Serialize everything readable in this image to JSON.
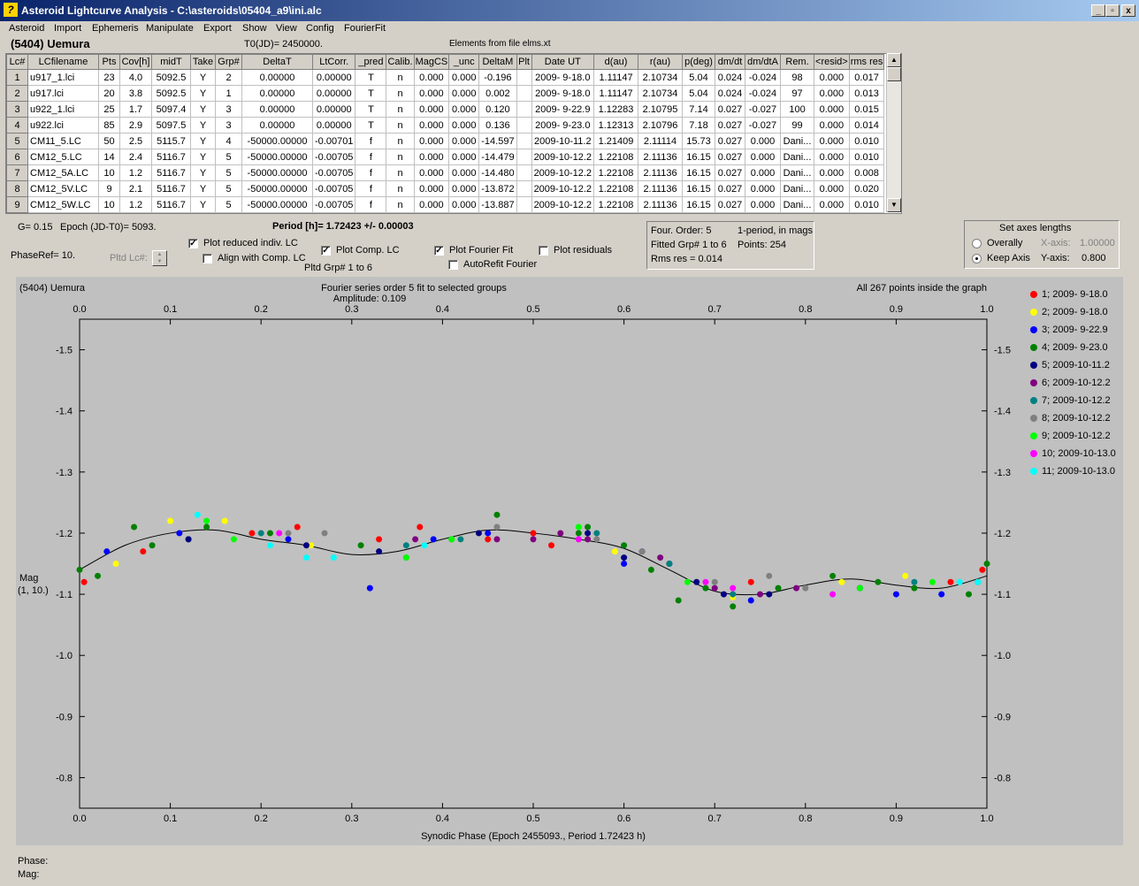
{
  "window": {
    "title": "Asteroid Lightcurve Analysis - C:\\asteroids\\05404_a9\\ini.alc",
    "min_label": "_",
    "max_label": "▫",
    "close_label": "x"
  },
  "menu": [
    "Asteroid",
    "Import",
    "Ephemeris",
    "Manipulate",
    "Export",
    "Show",
    "View",
    "Config",
    "FourierFit"
  ],
  "header": {
    "asteroid": "(5404) Uemura",
    "t0": "T0(JD)= 2450000.",
    "elements": "Elements from file elms.xt"
  },
  "table": {
    "columns": [
      "Lc#",
      "LCfilename",
      "Pts",
      "Cov[h]",
      "midT",
      "Take",
      "Grp#",
      "DeltaT",
      "LtCorr.",
      "_pred",
      "Calib.",
      "MagCS",
      "_unc",
      "DeltaM",
      "Plt",
      "Date UT",
      "d(au)",
      "r(au)",
      "p(deg)",
      "dm/dt",
      "dm/dtA",
      "Rem.",
      "<resid>",
      "rms res"
    ],
    "rows": [
      [
        "1",
        "u917_1.lci",
        "23",
        "4.0",
        "5092.5",
        "Y",
        "2",
        "0.00000",
        "0.00000",
        "T",
        "n",
        "0.000",
        "0.000",
        "-0.196",
        "",
        "2009- 9-18.0",
        "1.11147",
        "2.10734",
        "5.04",
        "0.024",
        "-0.024",
        "98",
        "0.000",
        "0.017"
      ],
      [
        "2",
        "u917.lci",
        "20",
        "3.8",
        "5092.5",
        "Y",
        "1",
        "0.00000",
        "0.00000",
        "T",
        "n",
        "0.000",
        "0.000",
        "0.002",
        "",
        "2009- 9-18.0",
        "1.11147",
        "2.10734",
        "5.04",
        "0.024",
        "-0.024",
        "97",
        "0.000",
        "0.013"
      ],
      [
        "3",
        "u922_1.lci",
        "25",
        "1.7",
        "5097.4",
        "Y",
        "3",
        "0.00000",
        "0.00000",
        "T",
        "n",
        "0.000",
        "0.000",
        "0.120",
        "",
        "2009- 9-22.9",
        "1.12283",
        "2.10795",
        "7.14",
        "0.027",
        "-0.027",
        "100",
        "0.000",
        "0.015"
      ],
      [
        "4",
        "u922.lci",
        "85",
        "2.9",
        "5097.5",
        "Y",
        "3",
        "0.00000",
        "0.00000",
        "T",
        "n",
        "0.000",
        "0.000",
        "0.136",
        "",
        "2009- 9-23.0",
        "1.12313",
        "2.10796",
        "7.18",
        "0.027",
        "-0.027",
        "99",
        "0.000",
        "0.014"
      ],
      [
        "5",
        "CM11_5.LC",
        "50",
        "2.5",
        "5115.7",
        "Y",
        "4",
        "-50000.00000",
        "-0.00701",
        "f",
        "n",
        "0.000",
        "0.000",
        "-14.597",
        "",
        "2009-10-11.2",
        "1.21409",
        "2.11114",
        "15.73",
        "0.027",
        "0.000",
        "Dani...",
        "0.000",
        "0.010"
      ],
      [
        "6",
        "CM12_5.LC",
        "14",
        "2.4",
        "5116.7",
        "Y",
        "5",
        "-50000.00000",
        "-0.00705",
        "f",
        "n",
        "0.000",
        "0.000",
        "-14.479",
        "",
        "2009-10-12.2",
        "1.22108",
        "2.11136",
        "16.15",
        "0.027",
        "0.000",
        "Dani...",
        "0.000",
        "0.010"
      ],
      [
        "7",
        "CM12_5A.LC",
        "10",
        "1.2",
        "5116.7",
        "Y",
        "5",
        "-50000.00000",
        "-0.00705",
        "f",
        "n",
        "0.000",
        "0.000",
        "-14.480",
        "",
        "2009-10-12.2",
        "1.22108",
        "2.11136",
        "16.15",
        "0.027",
        "0.000",
        "Dani...",
        "0.000",
        "0.008"
      ],
      [
        "8",
        "CM12_5V.LC",
        "9",
        "2.1",
        "5116.7",
        "Y",
        "5",
        "-50000.00000",
        "-0.00705",
        "f",
        "n",
        "0.000",
        "0.000",
        "-13.872",
        "",
        "2009-10-12.2",
        "1.22108",
        "2.11136",
        "16.15",
        "0.027",
        "0.000",
        "Dani...",
        "0.000",
        "0.020"
      ],
      [
        "9",
        "CM12_5W.LC",
        "10",
        "1.2",
        "5116.7",
        "Y",
        "5",
        "-50000.00000",
        "-0.00705",
        "f",
        "n",
        "0.000",
        "0.000",
        "-13.887",
        "",
        "2009-10-12.2",
        "1.22108",
        "2.11136",
        "16.15",
        "0.027",
        "0.000",
        "Dani...",
        "0.000",
        "0.010"
      ]
    ]
  },
  "params": {
    "g": "G= 0.15",
    "epoch": "Epoch (JD-T0)= 5093.",
    "period": "Period [h]= 1.72423 +/- 0.00003",
    "phaseref": "PhaseRef= 10.",
    "pltd_lc": "Pltd Lc#:",
    "pltd_grp": "Pltd Grp#  1   to   6"
  },
  "options": {
    "plot_reduced": {
      "label": "Plot reduced indiv. LC",
      "checked": true
    },
    "align_comp": {
      "label": "Align with Comp. LC",
      "checked": false
    },
    "plot_comp": {
      "label": "Plot Comp. LC",
      "checked": true
    },
    "plot_fourier": {
      "label": "Plot Fourier Fit",
      "checked": true
    },
    "autorefit": {
      "label": "AutoRefit Fourier",
      "checked": false
    },
    "plot_residuals": {
      "label": "Plot residuals",
      "checked": false
    }
  },
  "fourier_info": {
    "order": "Four. Order:  5",
    "mode": "1-period, in mags",
    "fitted": "Fitted Grp# 1 to 6",
    "points": "Points: 254",
    "rms": "Rms res     = 0.014"
  },
  "axes_box": {
    "title": "Set axes lengths",
    "overally": "Overally",
    "keep": "Keep Axis",
    "x_label": "X-axis:",
    "x_value": "1.00000",
    "y_label": "Y-axis:",
    "y_value": "0.800",
    "selected": "keep"
  },
  "plot": {
    "name": "(5404) Uemura",
    "fit_title": "Fourier series order 5 fit to selected groups",
    "amplitude": "Amplitude: 0.109",
    "points_note": "All 267 points inside the graph",
    "ylabel": "Mag",
    "ylabel2": "(1, 10.)",
    "xlabel": "Synodic Phase (Epoch 2455093., Period 1.72423 h)"
  },
  "legend": [
    {
      "label": "1; 2009- 9-18.0",
      "color": "#ff0000"
    },
    {
      "label": "2; 2009- 9-18.0",
      "color": "#ffff00"
    },
    {
      "label": "3; 2009- 9-22.9",
      "color": "#0000ff"
    },
    {
      "label": "4; 2009- 9-23.0",
      "color": "#008000"
    },
    {
      "label": "5; 2009-10-11.2",
      "color": "#000080"
    },
    {
      "label": "6; 2009-10-12.2",
      "color": "#800080"
    },
    {
      "label": "7; 2009-10-12.2",
      "color": "#008080"
    },
    {
      "label": "8; 2009-10-12.2",
      "color": "#808080"
    },
    {
      "label": "9; 2009-10-12.2",
      "color": "#00ff00"
    },
    {
      "label": "10; 2009-10-13.0",
      "color": "#ff00ff"
    },
    {
      "label": "11; 2009-10-13.0",
      "color": "#00ffff"
    }
  ],
  "status": {
    "phase": "Phase:",
    "mag": "Mag:"
  },
  "chart_data": {
    "type": "scatter",
    "xlabel": "Synodic Phase (Epoch 2455093., Period 1.72423 h)",
    "ylabel": "Mag",
    "xlim": [
      0.0,
      1.0
    ],
    "ylim": [
      -1.55,
      -0.75
    ],
    "y_inverted": true,
    "xticks": [
      "0.0",
      "0.1",
      "0.2",
      "0.3",
      "0.4",
      "0.5",
      "0.6",
      "0.7",
      "0.8",
      "0.9",
      "1.0"
    ],
    "yticks": [
      "-1.5",
      "-1.4",
      "-1.3",
      "-1.2",
      "-1.1",
      "-1.0",
      "-0.9",
      "-0.8"
    ],
    "fit_curve": {
      "name": "Fourier fit",
      "x": [
        0.0,
        0.05,
        0.1,
        0.15,
        0.2,
        0.25,
        0.3,
        0.35,
        0.4,
        0.45,
        0.5,
        0.55,
        0.6,
        0.65,
        0.7,
        0.75,
        0.8,
        0.85,
        0.9,
        0.95,
        1.0
      ],
      "y": [
        -1.14,
        -1.18,
        -1.2,
        -1.205,
        -1.19,
        -1.18,
        -1.165,
        -1.17,
        -1.19,
        -1.205,
        -1.2,
        -1.19,
        -1.175,
        -1.14,
        -1.105,
        -1.1,
        -1.115,
        -1.125,
        -1.115,
        -1.11,
        -1.13
      ]
    },
    "series": [
      {
        "name": "1; 2009- 9-18.0",
        "color": "#ff0000",
        "points": [
          [
            0.005,
            -1.12
          ],
          [
            0.07,
            -1.17
          ],
          [
            0.19,
            -1.2
          ],
          [
            0.24,
            -1.21
          ],
          [
            0.33,
            -1.19
          ],
          [
            0.375,
            -1.21
          ],
          [
            0.45,
            -1.19
          ],
          [
            0.5,
            -1.2
          ],
          [
            0.52,
            -1.18
          ],
          [
            0.74,
            -1.12
          ],
          [
            0.96,
            -1.12
          ],
          [
            0.995,
            -1.14
          ]
        ]
      },
      {
        "name": "2; 2009- 9-18.0",
        "color": "#ffff00",
        "points": [
          [
            0.04,
            -1.15
          ],
          [
            0.1,
            -1.22
          ],
          [
            0.16,
            -1.22
          ],
          [
            0.255,
            -1.18
          ],
          [
            0.42,
            -1.19
          ],
          [
            0.59,
            -1.17
          ],
          [
            0.72,
            -1.095
          ],
          [
            0.84,
            -1.12
          ],
          [
            0.91,
            -1.13
          ]
        ]
      },
      {
        "name": "3; 2009- 9-22.9",
        "color": "#0000ff",
        "points": [
          [
            0.03,
            -1.17
          ],
          [
            0.11,
            -1.2
          ],
          [
            0.23,
            -1.19
          ],
          [
            0.32,
            -1.11
          ],
          [
            0.39,
            -1.19
          ],
          [
            0.45,
            -1.2
          ],
          [
            0.6,
            -1.15
          ],
          [
            0.62,
            -1.17
          ],
          [
            0.74,
            -1.09
          ],
          [
            0.9,
            -1.1
          ],
          [
            0.95,
            -1.1
          ]
        ]
      },
      {
        "name": "4; 2009- 9-23.0",
        "color": "#008000",
        "points": [
          [
            0.0,
            -1.14
          ],
          [
            0.02,
            -1.13
          ],
          [
            0.06,
            -1.21
          ],
          [
            0.08,
            -1.18
          ],
          [
            0.12,
            -1.19
          ],
          [
            0.14,
            -1.21
          ],
          [
            0.21,
            -1.2
          ],
          [
            0.31,
            -1.18
          ],
          [
            0.36,
            -1.16
          ],
          [
            0.41,
            -1.19
          ],
          [
            0.46,
            -1.23
          ],
          [
            0.55,
            -1.2
          ],
          [
            0.56,
            -1.21
          ],
          [
            0.6,
            -1.18
          ],
          [
            0.63,
            -1.14
          ],
          [
            0.66,
            -1.09
          ],
          [
            0.69,
            -1.11
          ],
          [
            0.72,
            -1.08
          ],
          [
            0.77,
            -1.11
          ],
          [
            0.83,
            -1.13
          ],
          [
            0.88,
            -1.12
          ],
          [
            0.92,
            -1.11
          ],
          [
            0.98,
            -1.1
          ],
          [
            1.0,
            -1.15
          ]
        ]
      },
      {
        "name": "5; 2009-10-11.2",
        "color": "#000080",
        "points": [
          [
            0.12,
            -1.19
          ],
          [
            0.25,
            -1.18
          ],
          [
            0.33,
            -1.17
          ],
          [
            0.44,
            -1.2
          ],
          [
            0.56,
            -1.2
          ],
          [
            0.6,
            -1.16
          ],
          [
            0.65,
            -1.15
          ],
          [
            0.68,
            -1.12
          ],
          [
            0.71,
            -1.1
          ],
          [
            0.76,
            -1.1
          ],
          [
            0.86,
            -1.11
          ]
        ]
      },
      {
        "name": "6; 2009-10-12.2",
        "color": "#800080",
        "points": [
          [
            0.37,
            -1.19
          ],
          [
            0.46,
            -1.19
          ],
          [
            0.5,
            -1.19
          ],
          [
            0.53,
            -1.2
          ],
          [
            0.56,
            -1.19
          ],
          [
            0.64,
            -1.16
          ],
          [
            0.7,
            -1.11
          ],
          [
            0.75,
            -1.1
          ],
          [
            0.79,
            -1.11
          ]
        ]
      },
      {
        "name": "7; 2009-10-12.2",
        "color": "#008080",
        "points": [
          [
            0.2,
            -1.2
          ],
          [
            0.36,
            -1.18
          ],
          [
            0.42,
            -1.19
          ],
          [
            0.57,
            -1.2
          ],
          [
            0.65,
            -1.15
          ],
          [
            0.72,
            -1.1
          ],
          [
            0.86,
            -1.11
          ],
          [
            0.92,
            -1.12
          ],
          [
            0.99,
            -1.12
          ]
        ]
      },
      {
        "name": "8; 2009-10-12.2",
        "color": "#808080",
        "points": [
          [
            0.23,
            -1.2
          ],
          [
            0.27,
            -1.2
          ],
          [
            0.46,
            -1.21
          ],
          [
            0.57,
            -1.19
          ],
          [
            0.62,
            -1.17
          ],
          [
            0.7,
            -1.12
          ],
          [
            0.76,
            -1.13
          ],
          [
            0.8,
            -1.11
          ]
        ]
      },
      {
        "name": "9; 2009-10-12.2",
        "color": "#00ff00",
        "points": [
          [
            0.14,
            -1.22
          ],
          [
            0.17,
            -1.19
          ],
          [
            0.36,
            -1.16
          ],
          [
            0.41,
            -1.19
          ],
          [
            0.55,
            -1.21
          ],
          [
            0.67,
            -1.12
          ],
          [
            0.86,
            -1.11
          ],
          [
            0.94,
            -1.12
          ]
        ]
      },
      {
        "name": "10; 2009-10-13.0",
        "color": "#ff00ff",
        "points": [
          [
            0.22,
            -1.2
          ],
          [
            0.55,
            -1.19
          ],
          [
            0.69,
            -1.12
          ],
          [
            0.72,
            -1.11
          ],
          [
            0.83,
            -1.1
          ]
        ]
      },
      {
        "name": "11; 2009-10-13.0",
        "color": "#00ffff",
        "points": [
          [
            0.13,
            -1.23
          ],
          [
            0.21,
            -1.18
          ],
          [
            0.25,
            -1.16
          ],
          [
            0.28,
            -1.16
          ],
          [
            0.38,
            -1.18
          ],
          [
            0.97,
            -1.12
          ],
          [
            0.99,
            -1.12
          ]
        ]
      }
    ]
  }
}
